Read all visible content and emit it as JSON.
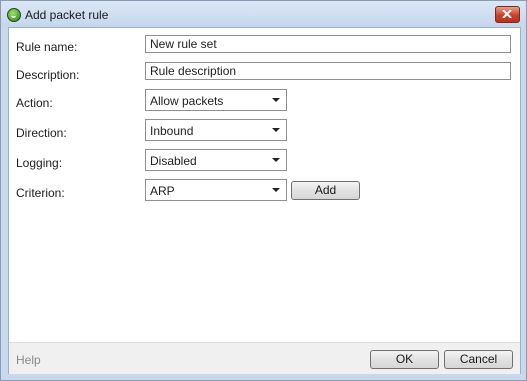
{
  "window": {
    "title": "Add packet rule"
  },
  "form": {
    "rule_name": {
      "label": "Rule name:",
      "value": "New rule set"
    },
    "description": {
      "label": "Description:",
      "value": "Rule description"
    },
    "action": {
      "label": "Action:",
      "value": "Allow packets"
    },
    "direction": {
      "label": "Direction:",
      "value": "Inbound"
    },
    "logging": {
      "label": "Logging:",
      "value": "Disabled"
    },
    "criterion": {
      "label": "Criterion:",
      "value": "ARP",
      "add_label": "Add"
    }
  },
  "footer": {
    "help_label": "Help",
    "ok_label": "OK",
    "cancel_label": "Cancel"
  },
  "icons": {
    "app": "shield-app-icon",
    "close": "close-icon",
    "dropdown": "chevron-down-icon"
  }
}
